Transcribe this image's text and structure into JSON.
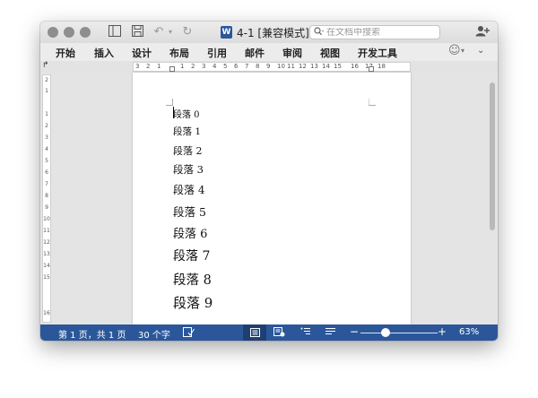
{
  "window": {
    "title": "4-1 [兼容模式]",
    "app_badge": "W"
  },
  "toolbar": {
    "search_placeholder": "在文档中搜索"
  },
  "ribbon": {
    "tabs": [
      "开始",
      "插入",
      "设计",
      "布局",
      "引用",
      "邮件",
      "审阅",
      "视图",
      "开发工具"
    ]
  },
  "ruler": {
    "horizontal": [
      "3",
      "2",
      "1",
      "1",
      "2",
      "3",
      "4",
      "5",
      "6",
      "7",
      "8",
      "9",
      "10",
      "11",
      "12",
      "13",
      "14",
      "15",
      "16",
      "17",
      "18"
    ],
    "vertical": [
      "2",
      "1",
      "1",
      "2",
      "3",
      "4",
      "5",
      "6",
      "7",
      "8",
      "9",
      "10",
      "11",
      "12",
      "13",
      "14",
      "15",
      "16"
    ]
  },
  "document": {
    "paragraphs": [
      "段落 0",
      "段落 1",
      "段落 2",
      "段落 3",
      "段落 4",
      "段落 5",
      "段落 6",
      "段落 7",
      "段落 8",
      "段落 9"
    ]
  },
  "status": {
    "page_info": "第 1 页，共 1 页",
    "word_count": "30 个字",
    "zoom": "63%",
    "zoom_minus": "−",
    "zoom_plus": "+"
  },
  "colors": {
    "statusbar": "#2b579a",
    "word_brand": "#2b579a"
  }
}
